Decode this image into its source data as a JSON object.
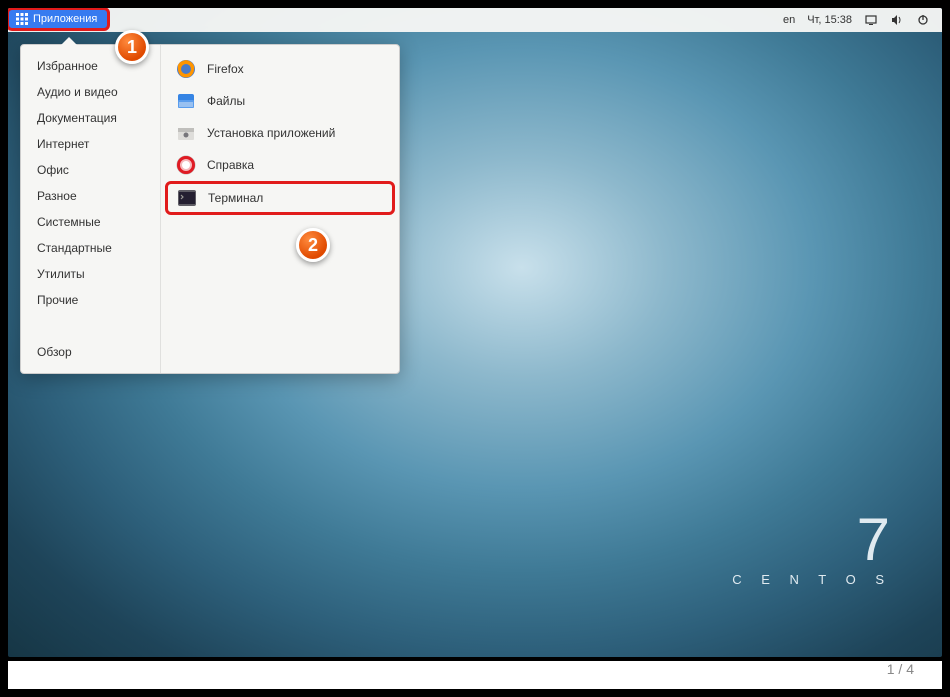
{
  "topbar": {
    "app_button_label": "Приложения",
    "language": "en",
    "datetime": "Чт, 15:38"
  },
  "menu": {
    "categories": [
      "Избранное",
      "Аудио и видео",
      "Документация",
      "Интернет",
      "Офис",
      "Разное",
      "Системные",
      "Стандартные",
      "Утилиты",
      "Прочие"
    ],
    "overview_label": "Обзор",
    "items": [
      {
        "label": "Firefox",
        "icon": "firefox"
      },
      {
        "label": "Файлы",
        "icon": "files"
      },
      {
        "label": "Установка приложений",
        "icon": "software"
      },
      {
        "label": "Справка",
        "icon": "help"
      },
      {
        "label": "Терминал",
        "icon": "terminal"
      }
    ]
  },
  "callouts": {
    "one": "1",
    "two": "2"
  },
  "branding": {
    "version": "7",
    "name": "C E N T O S"
  },
  "pagination": "1 / 4"
}
